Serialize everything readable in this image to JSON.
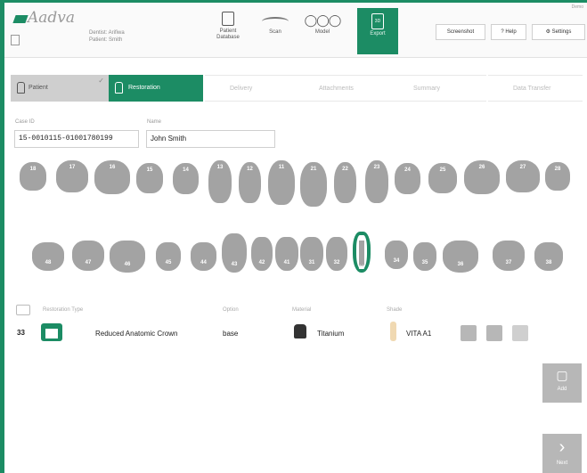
{
  "app": {
    "logo_text": "Aadva"
  },
  "patient": {
    "line1": "Dentist: Arifiwa",
    "line2": "Patient: Smith"
  },
  "toolbar": {
    "tools": [
      {
        "label": "Patient\nDatabase",
        "icon": "database-icon"
      },
      {
        "label": "Scan",
        "icon": "scan-icon"
      },
      {
        "label": "Model",
        "icon": "model-icon"
      },
      {
        "label": "Export",
        "icon": "export-icon",
        "active": true
      }
    ],
    "screenshot_label": "Screenshot",
    "help_label": "Help",
    "settings_label": "Settings",
    "corner_label": "Demo"
  },
  "workflow": {
    "tabs": [
      "Patient",
      "Restoration",
      "Delivery",
      "Attachments",
      "Summary",
      "Data Transfer"
    ],
    "active_index": 1
  },
  "fields": {
    "case_id_label": "Case ID",
    "case_id_value": "15-0010115-01001780199",
    "name_label": "Name",
    "name_value": "John Smith"
  },
  "teeth": {
    "upper": [
      "18",
      "17",
      "16",
      "15",
      "14",
      "13",
      "12",
      "11",
      "21",
      "22",
      "23",
      "24",
      "25",
      "26",
      "27",
      "28"
    ],
    "lower": [
      "48",
      "47",
      "46",
      "45",
      "44",
      "43",
      "42",
      "41",
      "31",
      "32",
      "33",
      "34",
      "35",
      "36",
      "37",
      "38"
    ],
    "selected": "33"
  },
  "restorations": {
    "headers": {
      "type": "Restoration Type",
      "option": "Option",
      "material": "Material",
      "shade": "Shade"
    },
    "rows": [
      {
        "tooth": "33",
        "type": "Reduced Anatomic Crown",
        "option": "base",
        "material": "Titanium",
        "shade": "VITA A1",
        "icon": "crown-icon"
      }
    ]
  },
  "side_buttons": {
    "add_label": "Add",
    "next_label": "Next"
  },
  "colors": {
    "accent": "#1c8c64",
    "tooth": "#a3a3a3",
    "button_grey": "#b7b7b7"
  }
}
